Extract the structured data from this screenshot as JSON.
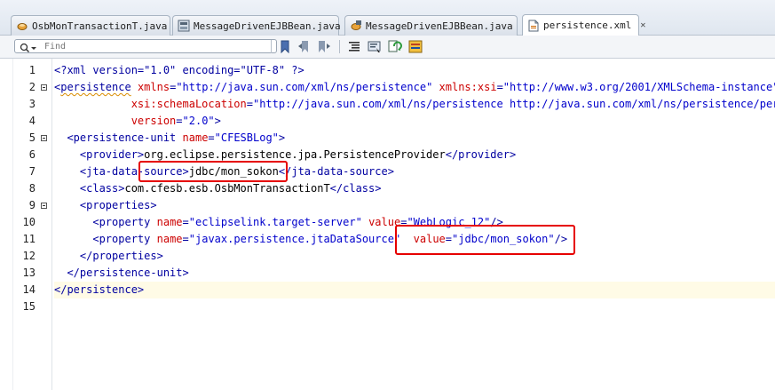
{
  "tabs": [
    {
      "label": "OsbMonTransactionT.java",
      "icon": "java-class-icon",
      "active": false
    },
    {
      "label": "MessageDrivenEJBBean.java",
      "icon": "ejb-bean-icon",
      "active": false
    },
    {
      "label": "MessageDrivenEJBBean.java",
      "icon": "ejb-bean-icon",
      "active": false
    },
    {
      "label": "persistence.xml",
      "icon": "xml-file-icon",
      "active": true
    }
  ],
  "toolbar": {
    "find_placeholder": "Find",
    "buttons": [
      "bookmark-icon",
      "previous-bookmark-icon",
      "next-bookmark-icon",
      "indent-icon",
      "comment-icon",
      "refresh-icon",
      "palette-icon"
    ]
  },
  "editor": {
    "line_numbers": [
      "1",
      "2",
      "3",
      "4",
      "5",
      "6",
      "7",
      "8",
      "9",
      "10",
      "11",
      "12",
      "13",
      "14",
      "15"
    ],
    "lines": [
      [
        "<?xml version=\"1.0\" encoding=\"UTF-8\" ?>"
      ],
      [
        "<",
        "persistence",
        " ",
        "xmlns",
        "=",
        "\"http://java.sun.com/xml/ns/persistence\"",
        " ",
        "xmlns:xsi",
        "=",
        "\"http://www.w3.org/2001/XMLSchema-instance\""
      ],
      [
        "xsi:schemaLocation",
        "=",
        "\"http://java.sun.com/xml/ns/persistence http://java.sun.com/xml/ns/persistence/persi"
      ],
      [
        "version",
        "=",
        "\"2.0\"",
        ">"
      ],
      [
        "<persistence-unit",
        " ",
        "name",
        "=",
        "\"CFESBLog\"",
        ">"
      ],
      [
        "<provider>",
        "org.eclipse.persistence.jpa.PersistenceProvider",
        "</provider>"
      ],
      [
        "<jta-data-source>",
        "jdbc/mon_sokon",
        "</jta-data-source>"
      ],
      [
        "<class>",
        "com.cfesb.esb.OsbMonTransactionT",
        "</class>"
      ],
      [
        "<properties>"
      ],
      [
        "<property",
        " ",
        "name",
        "=",
        "\"eclipselink.target-server\"",
        " ",
        "value",
        "=",
        "\"WebLogic_12\"",
        "/>"
      ],
      [
        "<property",
        " ",
        "name",
        "=",
        "\"javax.persistence.jtaDataSource\"",
        " ",
        "value",
        "=",
        "\"jdbc/mon_sokon\"",
        "/>"
      ],
      [
        "</properties>"
      ],
      [
        "</persistence-unit>"
      ],
      [
        "</persistence>"
      ],
      [
        ""
      ]
    ]
  },
  "colors": {
    "tag": "#0000a0",
    "attribute": "#cc0000",
    "value": "#0000cc",
    "highlight": "#e60000",
    "current_line": "#fffbe6"
  }
}
